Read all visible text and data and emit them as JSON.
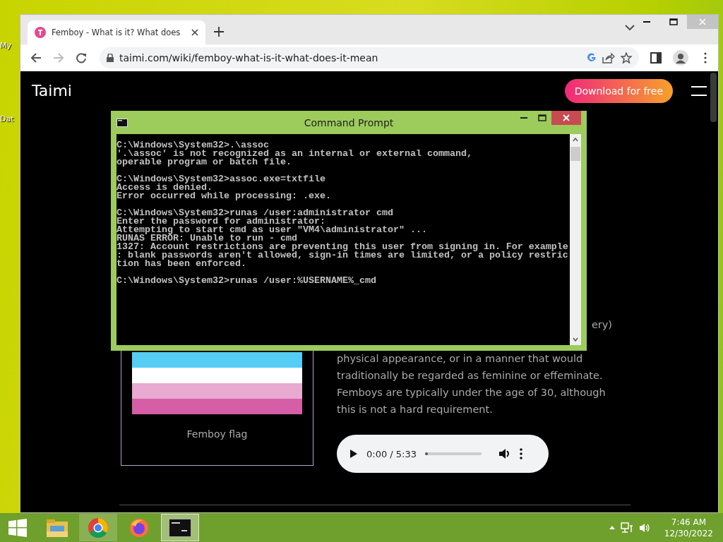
{
  "desktop": {
    "icons": [
      {
        "label": "My"
      },
      {
        "label": "Dat"
      }
    ]
  },
  "browser": {
    "tabs": [
      {
        "title": "Femboy - What is it? What does",
        "selected": true
      }
    ],
    "url": "taimi.com/wiki/femboy-what-is-it-what-does-it-mean",
    "page": {
      "logo": "Taimi",
      "cta": "Download for free",
      "figure": {
        "caption": "Femboy flag"
      },
      "text_lines": [
        "ery)",
        "physical appearance, or in a manner that would",
        "traditionally be regarded as feminine or effeminate.",
        "Femboys are typically under the age of 30, although",
        "this is not a hard requirement."
      ],
      "audio": {
        "time": "0:00 / 5:33",
        "level": 0.05
      }
    }
  },
  "console": {
    "title": "Command Prompt",
    "blocks": [
      [
        "C:\\Windows\\System32>.\\assoc",
        "'.\\assoc' is not recognized as an internal or external command,",
        "operable program or batch file."
      ],
      [
        "C:\\Windows\\System32>assoc.exe=txtfile",
        "Access is denied.",
        "Error occurred while processing: .exe."
      ],
      [
        "C:\\Windows\\System32>runas /user:administrator cmd",
        "Enter the password for administrator:",
        "Attempting to start cmd as user \"VM4\\administrator\" ...",
        "RUNAS ERROR: Unable to run - cmd",
        "1327: Account restrictions are preventing this user from signing in. For example",
        ": blank passwords aren't allowed, sign-in times are limited, or a policy restric",
        "tion has been enforced."
      ],
      [
        "C:\\Windows\\System32>runas /user:%USERNAME%_cmd"
      ]
    ]
  },
  "taskbar": {
    "apps": [
      {
        "kind": "explorer",
        "running": false,
        "selected": false
      },
      {
        "kind": "chrome",
        "running": true,
        "selected": false
      },
      {
        "kind": "firefox",
        "running": false,
        "selected": false
      },
      {
        "kind": "console",
        "running": true,
        "selected": true
      }
    ],
    "time": "7:46 AM",
    "date": "12/30/2022"
  }
}
